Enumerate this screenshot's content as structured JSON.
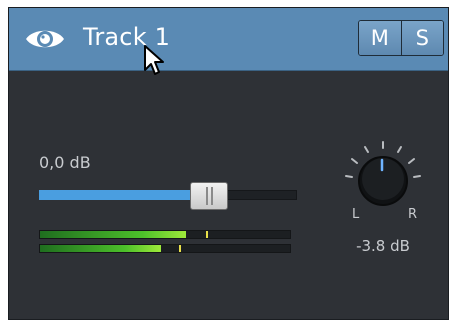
{
  "track": {
    "name": "Track 1",
    "visibility_icon": "eye-icon",
    "mute_label": "M",
    "solo_label": "S"
  },
  "volume": {
    "label": "0,0 dB",
    "level_fraction": 0.66
  },
  "meters": [
    {
      "name": "left",
      "level_fraction": 0.58,
      "peak_fraction": 0.66
    },
    {
      "name": "right",
      "level_fraction": 0.48,
      "peak_fraction": 0.55
    }
  ],
  "pan": {
    "left_label": "L",
    "right_label": "R",
    "value": "-3.8 dB",
    "knob_icon": "pan-knob"
  },
  "colors": {
    "header": "#5a8ab4",
    "panel": "#2e3136",
    "volume_fill": "#4a9ee0",
    "meter_green": "#4cc02a",
    "peak_yellow": "#e8e04a"
  }
}
